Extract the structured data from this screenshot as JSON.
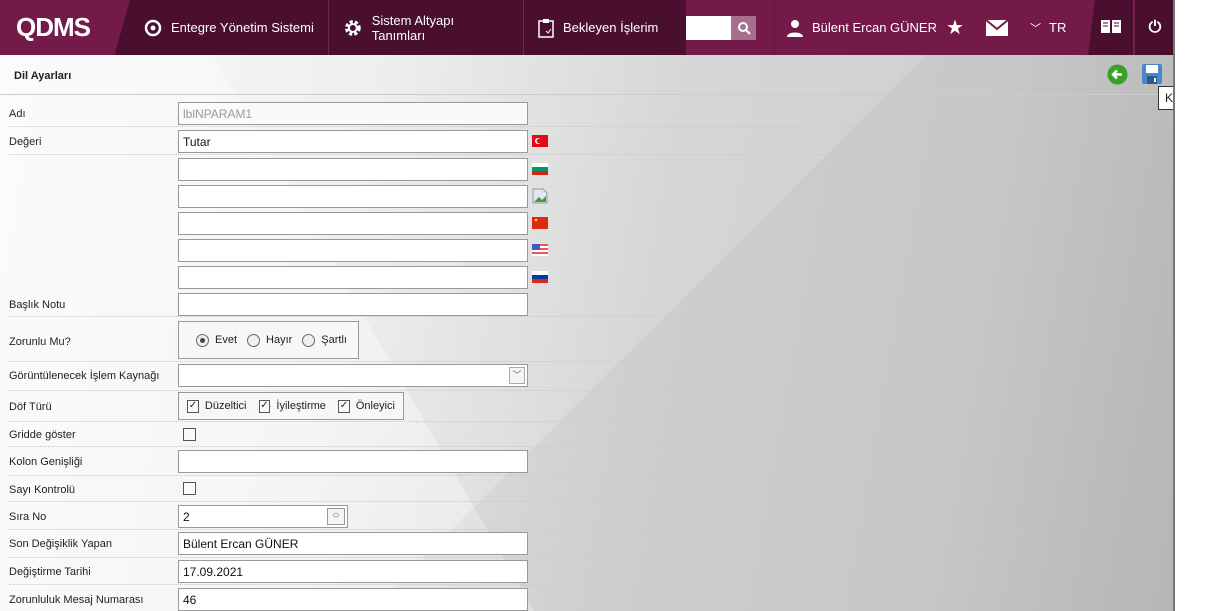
{
  "header": {
    "logo": "QDMS",
    "nav": [
      {
        "label": "Entegre Yönetim Sistemi",
        "icon": "q-logo-icon"
      },
      {
        "label": "Sistem Altyapı Tanımları",
        "icon": "gear-icon"
      },
      {
        "label": "Bekleyen İşlerim",
        "icon": "clipboard-check-icon"
      }
    ],
    "search_value": "",
    "user": "Bülent Ercan GÜNER",
    "lang": "TR",
    "colors": {
      "dark": "#4a0f2e",
      "accent": "#741a48"
    }
  },
  "page": {
    "title": "Dil Ayarları",
    "save_tooltip": "Kaydet"
  },
  "form": {
    "adi": {
      "label": "Adı",
      "value": "lblNPARAM1"
    },
    "degeri": {
      "label": "Değeri",
      "values": [
        "Tutar",
        "",
        "",
        "",
        "",
        ""
      ],
      "flags": [
        "tr",
        "bg",
        "broken-image",
        "cn",
        "us",
        "ru"
      ]
    },
    "baslik": {
      "label": "Başlık Notu",
      "value": ""
    },
    "zorunlu": {
      "label": "Zorunlu Mu?",
      "options": [
        "Evet",
        "Hayır",
        "Şartlı"
      ],
      "selected": "Evet"
    },
    "kaynak": {
      "label": "Görüntülenecek İşlem Kaynağı",
      "value": ""
    },
    "dof": {
      "label": "Döf Türü",
      "options": [
        "Düzeltici",
        "İyileştirme",
        "Önleyici"
      ],
      "checked": [
        true,
        true,
        true
      ]
    },
    "gridde": {
      "label": "Gridde göster",
      "checked": false
    },
    "kolon": {
      "label": "Kolon Genişliği",
      "value": ""
    },
    "sayi": {
      "label": "Sayı Kontrolü",
      "checked": false
    },
    "sira": {
      "label": "Sıra No",
      "value": "2"
    },
    "son": {
      "label": "Son Değişiklik Yapan",
      "value": "Bülent Ercan GÜNER"
    },
    "tarih": {
      "label": "Değiştirme Tarihi",
      "value": "17.09.2021"
    },
    "mesaj": {
      "label": "Zorunluluk Mesaj Numarası",
      "value": "46"
    }
  }
}
